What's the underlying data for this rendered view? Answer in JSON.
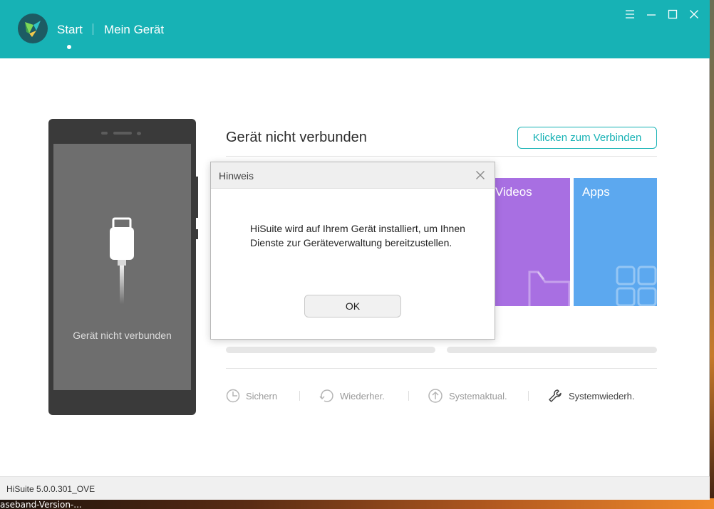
{
  "app": {
    "nav_start": "Start",
    "nav_device": "Mein Gerät",
    "version": "HiSuite 5.0.0.301_OVE",
    "accent_color": "#17b2b5"
  },
  "phone": {
    "status_label": "Gerät nicht verbunden"
  },
  "main": {
    "status_title": "Gerät nicht verbunden",
    "connect_button": "Klicken zum Verbinden",
    "tiles": [
      {
        "label": "Videos",
        "color": "#a86fe2",
        "icon": "video-icon"
      },
      {
        "label": "Apps",
        "color": "#5ca8ef",
        "icon": "apps-grid-icon"
      }
    ],
    "actions": [
      {
        "label": "Sichern",
        "icon": "backup-icon"
      },
      {
        "label": "Wiederher.",
        "icon": "restore-icon"
      },
      {
        "label": "Systemaktual.",
        "icon": "system-update-icon"
      },
      {
        "label": "Systemwiederh.",
        "icon": "wrench-icon"
      }
    ]
  },
  "dialog": {
    "title": "Hinweis",
    "message": "HiSuite wird auf Ihrem Gerät installiert, um Ihnen Dienste zur Geräteverwaltung bereitzustellen.",
    "ok_button": "OK"
  },
  "desktop": {
    "bottom_text": "aseband-Version-..."
  }
}
